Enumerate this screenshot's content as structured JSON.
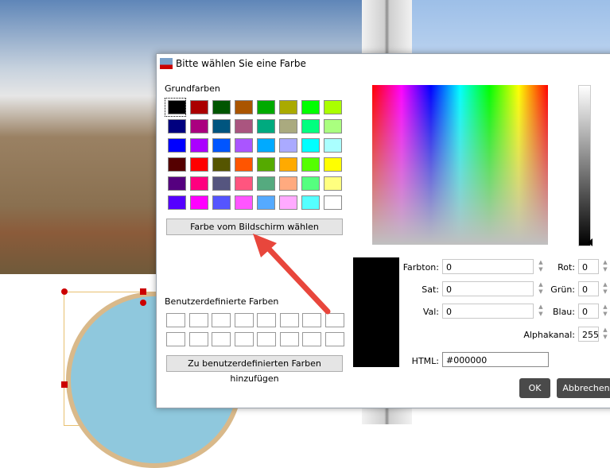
{
  "dialog": {
    "title": "Bitte wählen Sie eine Farbe",
    "basic_label": "Grundfarben",
    "pick_screen": "Farbe vom Bildschirm wählen",
    "custom_label": "Benutzerdefinierte Farben",
    "add_custom": "Zu benutzerdefinierten Farben hinzufügen",
    "basic_colors": [
      "#000000",
      "#aa0000",
      "#005500",
      "#aa5500",
      "#00aa00",
      "#aaaa00",
      "#00ff00",
      "#aaff00",
      "#00007f",
      "#aa007f",
      "#00557f",
      "#aa557f",
      "#00aa7f",
      "#aaaa7f",
      "#00ff7f",
      "#aaff7f",
      "#0000ff",
      "#aa00ff",
      "#0055ff",
      "#aa55ff",
      "#00aaff",
      "#aaaaff",
      "#00ffff",
      "#aaffff",
      "#550000",
      "#ff0000",
      "#555500",
      "#ff5500",
      "#55aa00",
      "#ffaa00",
      "#55ff00",
      "#ffff00",
      "#55007f",
      "#ff007f",
      "#55557f",
      "#ff557f",
      "#55aa7f",
      "#ffaa7f",
      "#55ff7f",
      "#ffff7f",
      "#5500ff",
      "#ff00ff",
      "#5555ff",
      "#ff55ff",
      "#55aaff",
      "#ffaaff",
      "#55ffff",
      "#ffffff"
    ],
    "selected_color": "#000000",
    "fields": {
      "hue_label": "Farbton:",
      "hue": "0",
      "sat_label": "Sat:",
      "sat": "0",
      "val_label": "Val:",
      "val": "0",
      "red_label": "Rot:",
      "red": "0",
      "green_label": "Grün:",
      "green": "0",
      "blue_label": "Blau:",
      "blue": "0",
      "alpha_label": "Alphakanal:",
      "alpha": "255",
      "html_label": "HTML:",
      "html": "#000000"
    },
    "ok": "OK",
    "cancel": "Abbrechen"
  }
}
